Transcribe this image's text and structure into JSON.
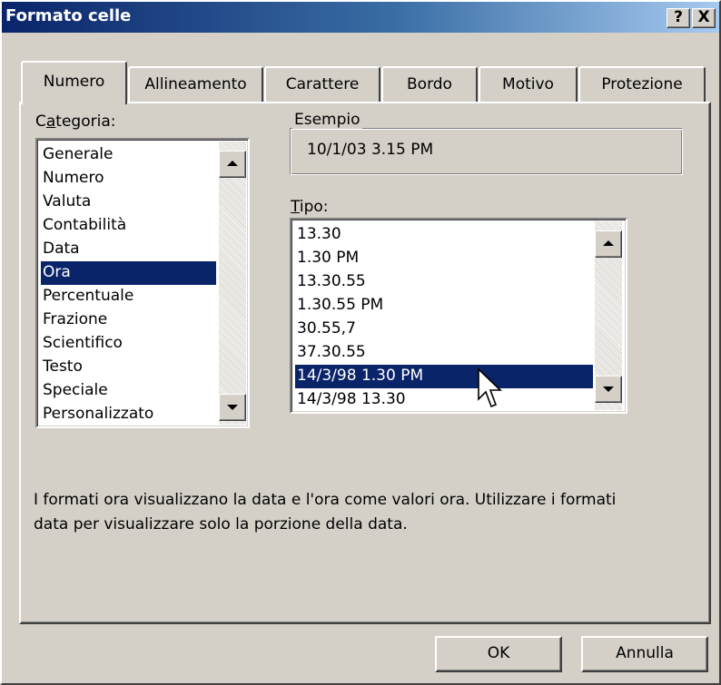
{
  "window": {
    "title": "Formato celle",
    "help_button": "?",
    "close_button": "X"
  },
  "tabs": [
    {
      "label": "Numero",
      "active": true
    },
    {
      "label": "Allineamento",
      "active": false
    },
    {
      "label": "Carattere",
      "active": false
    },
    {
      "label": "Bordo",
      "active": false
    },
    {
      "label": "Motivo",
      "active": false
    },
    {
      "label": "Protezione",
      "active": false
    }
  ],
  "categoria": {
    "label_pre": "C",
    "label_access": "a",
    "label_post": "tegoria:",
    "items": [
      "Generale",
      "Numero",
      "Valuta",
      "Contabilità",
      "Data",
      "Ora",
      "Percentuale",
      "Frazione",
      "Scientifico",
      "Testo",
      "Speciale",
      "Personalizzato"
    ],
    "selected": "Ora"
  },
  "esempio": {
    "caption": "Esempio",
    "value": "10/1/03 3.15 PM"
  },
  "tipo": {
    "label_access": "T",
    "label_post": "ipo:",
    "items": [
      "13.30",
      "1.30 PM",
      "13.30.55",
      "1.30.55 PM",
      "30.55,7",
      "37.30.55",
      "14/3/98 1.30 PM",
      "14/3/98 13.30"
    ],
    "selected": "14/3/98 1.30 PM"
  },
  "description": "I formati ora visualizzano la data e l'ora come valori ora. Utilizzare i formati\ndata per visualizzare solo la  porzione della data.",
  "buttons": {
    "ok": "OK",
    "cancel": "Annulla"
  },
  "colors": {
    "dialog_bg": "#d4d0c8",
    "selection": "#0a246a",
    "title_gradient_start": "#0a246a",
    "title_gradient_end": "#a6caf0"
  },
  "icons": {
    "scroll_up": "arrow-up-icon",
    "scroll_down": "arrow-down-icon",
    "pointer": "mouse-pointer-icon"
  }
}
